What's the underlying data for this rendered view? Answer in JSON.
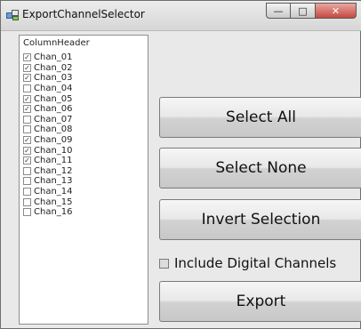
{
  "window": {
    "title": "ExportChannelSelector",
    "minimize": "—",
    "maximize": "□",
    "close": "✕"
  },
  "list": {
    "header": "ColumnHeader",
    "items": [
      {
        "label": "Chan_01",
        "checked": true
      },
      {
        "label": "Chan_02",
        "checked": true
      },
      {
        "label": "Chan_03",
        "checked": true
      },
      {
        "label": "Chan_04",
        "checked": false
      },
      {
        "label": "Chan_05",
        "checked": true
      },
      {
        "label": "Chan_06",
        "checked": true
      },
      {
        "label": "Chan_07",
        "checked": false
      },
      {
        "label": "Chan_08",
        "checked": false
      },
      {
        "label": "Chan_09",
        "checked": true
      },
      {
        "label": "Chan_10",
        "checked": true
      },
      {
        "label": "Chan_11",
        "checked": true
      },
      {
        "label": "Chan_12",
        "checked": false
      },
      {
        "label": "Chan_13",
        "checked": false
      },
      {
        "label": "Chan_14",
        "checked": false
      },
      {
        "label": "Chan_15",
        "checked": false
      },
      {
        "label": "Chan_16",
        "checked": false
      }
    ]
  },
  "buttons": {
    "select_all": "Select All",
    "select_none": "Select None",
    "invert_selection": "Invert Selection",
    "export": "Export"
  },
  "options": {
    "include_digital": "Include Digital Channels",
    "include_digital_checked": false
  }
}
